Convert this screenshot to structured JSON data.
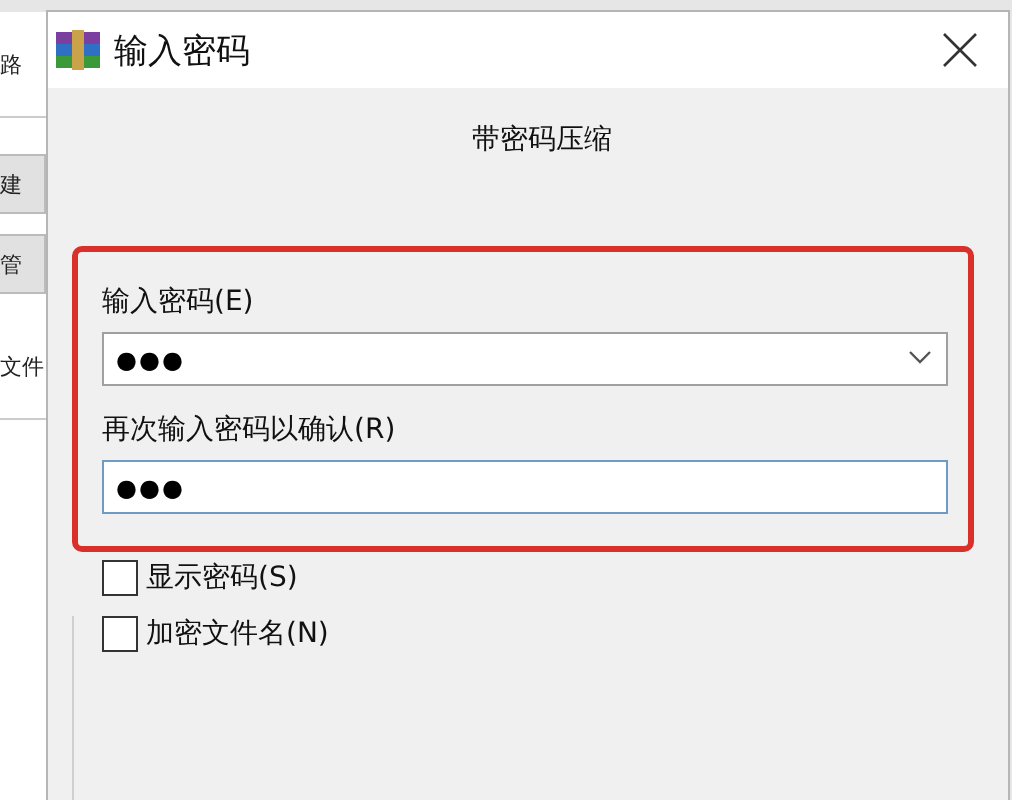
{
  "background_window": {
    "items": [
      {
        "text": "路",
        "kind": "label"
      },
      {
        "text": "建",
        "kind": "button"
      },
      {
        "text": "管",
        "kind": "button"
      },
      {
        "text": "文件",
        "kind": "label"
      }
    ]
  },
  "dialog": {
    "title": "输入密码",
    "heading": "带密码压缩",
    "fields": [
      {
        "label": "输入密码(E)",
        "value": "●●●",
        "kind": "combo",
        "focused": false
      },
      {
        "label": "再次输入密码以确认(R)",
        "value": "●●●",
        "kind": "text",
        "focused": true
      }
    ],
    "options": [
      {
        "label": "显示密码(S)",
        "checked": false
      },
      {
        "label": "加密文件名(N)",
        "checked": false
      }
    ]
  }
}
